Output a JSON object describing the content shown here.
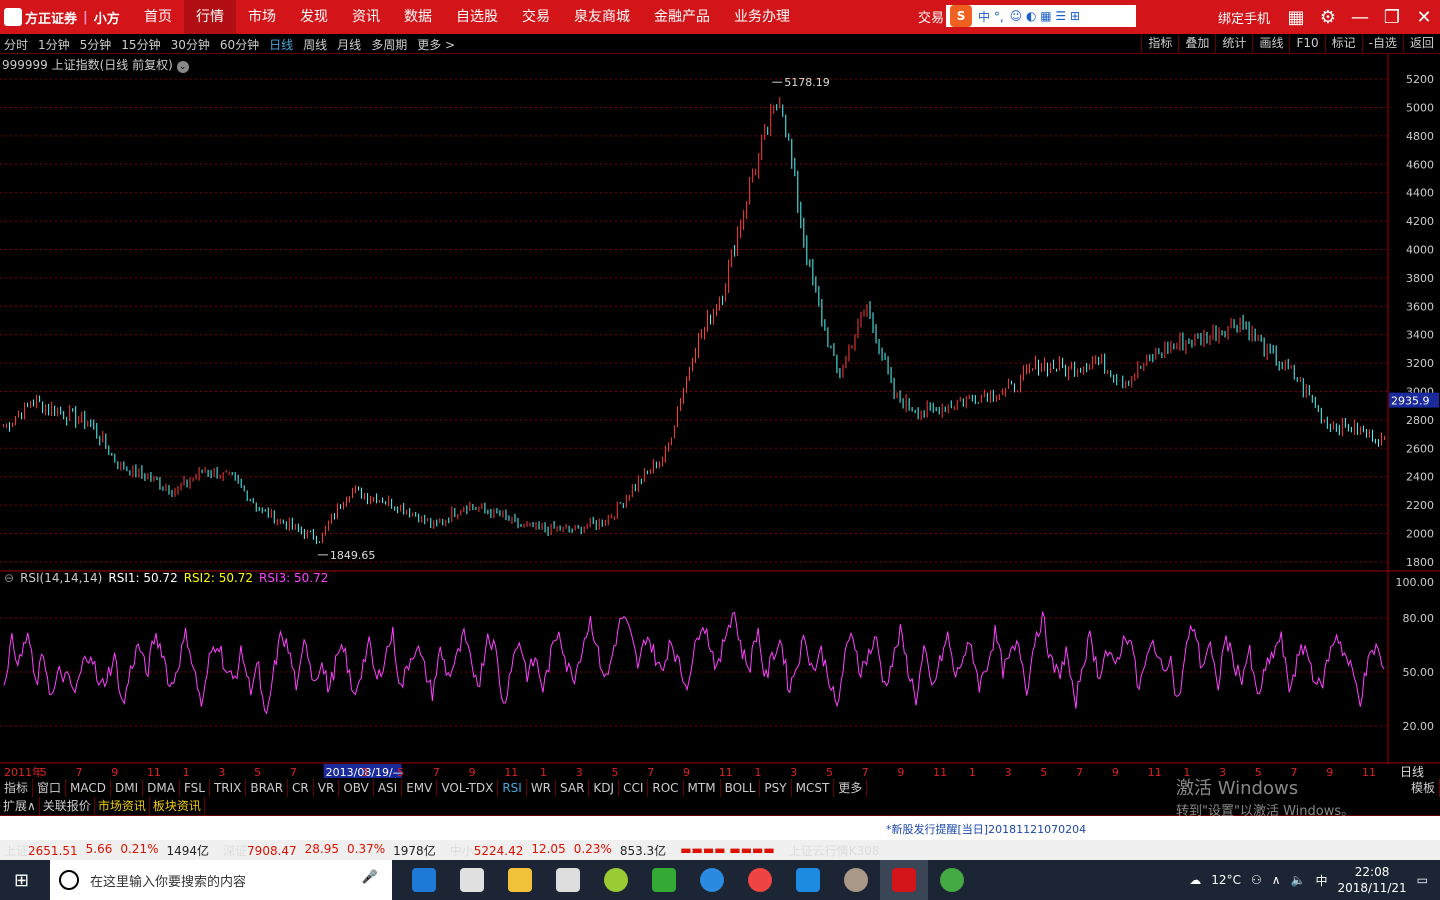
{
  "app": {
    "logo_text": "方正证券",
    "logo_sub": "小方",
    "nav": [
      "首页",
      "行情",
      "市场",
      "发现",
      "资讯",
      "数据",
      "自选股",
      "交易",
      "泉友商城",
      "金融产品",
      "业务办理"
    ],
    "nav_active": "行情",
    "trade_label": "交易",
    "ime_chars": "中 °,",
    "bind_phone": "绑定手机"
  },
  "periodbar": {
    "periods": [
      "分时",
      "1分钟",
      "5分钟",
      "15分钟",
      "30分钟",
      "60分钟",
      "日线",
      "周线",
      "月线",
      "多周期",
      "更多 >"
    ],
    "active": "日线",
    "tools": [
      "指标",
      "叠加",
      "统计",
      "画线",
      "F10",
      "标记",
      "-自选",
      "返回"
    ]
  },
  "chart_info": "999999 上证指数(日线 前复权)",
  "rsi_info": {
    "name": "RSI(14,14,14)",
    "rsi1": "RSI1: 50.72",
    "rsi2": "RSI2: 50.72",
    "rsi3": "RSI3: 50.72"
  },
  "date_labels": [
    "2011年",
    "5",
    "7",
    "9",
    "11",
    "1",
    "3",
    "5",
    "7",
    "2013/08/19/—",
    "3",
    "5",
    "7",
    "9",
    "11",
    "1",
    "3",
    "5",
    "7",
    "9",
    "11",
    "1",
    "3",
    "5",
    "7",
    "9",
    "11",
    "1",
    "3",
    "5",
    "7",
    "9",
    "11",
    "1",
    "3",
    "5",
    "7",
    "9",
    "11"
  ],
  "period_right": "日线",
  "indicator_tabs": [
    "指标",
    "窗口",
    "MACD",
    "DMI",
    "DMA",
    "FSL",
    "TRIX",
    "BRAR",
    "CR",
    "VR",
    "OBV",
    "ASI",
    "EMV",
    "VOL-TDX",
    "RSI",
    "WR",
    "SAR",
    "KDJ",
    "CCI",
    "ROC",
    "MTM",
    "BOLL",
    "PSY",
    "MCST",
    "更多"
  ],
  "indicator_active": "RSI",
  "template_label": "模板",
  "expand_tabs": [
    "扩展∧",
    "关联报价",
    "市场资讯",
    "板块资讯"
  ],
  "notice": "*新股发行提醒[当日]20181121070204",
  "status": {
    "sh": {
      "name": "上证",
      "price": "2651.51",
      "chg": "5.66",
      "pct": "0.21%",
      "amt": "1494亿"
    },
    "sz": {
      "name": "深证",
      "price": "7908.47",
      "chg": "28.95",
      "pct": "0.37%",
      "amt": "1978亿"
    },
    "zx": {
      "name": "中小",
      "price": "5224.42",
      "chg": "12.05",
      "pct": "0.23%",
      "amt": "853.3亿"
    },
    "cloud": "上证云行情K308"
  },
  "watermark": {
    "line1": "激活 Windows",
    "line2": "转到\"设置\"以激活 Windows。"
  },
  "taskbar": {
    "search_placeholder": "在这里输入你要搜索的内容",
    "weather": "12°C",
    "ime": "中",
    "time": "22:08",
    "date": "2018/11/21"
  },
  "colors": {
    "up": "#ff3c3c",
    "down": "#54ffff",
    "rsi": "#ff40ff",
    "grid": "#7a0000",
    "axis": "#a00000"
  },
  "chart_data": [
    {
      "type": "candlestick",
      "title": "999999 上证指数(日线 前复权)",
      "ylim": [
        1750,
        5250
      ],
      "y_ticks": [
        1800,
        2000,
        2200,
        2400,
        2600,
        2800,
        3000,
        3200,
        3400,
        3600,
        3800,
        4000,
        4200,
        4400,
        4600,
        4800,
        5000,
        5200
      ],
      "annotations": [
        {
          "label": "5178.19",
          "value": 5178.19
        },
        {
          "label": "1849.65",
          "value": 1849.65
        }
      ],
      "current_price_label": "2935.9",
      "current_price": 2935.9,
      "x": [
        "2011-01",
        "2011-03",
        "2011-05",
        "2011-07",
        "2011-09",
        "2011-11",
        "2012-01",
        "2012-03",
        "2012-05",
        "2012-07",
        "2012-09",
        "2012-11",
        "2013-01",
        "2013-03",
        "2013-05",
        "2013-07",
        "2013-09",
        "2013-11",
        "2014-01",
        "2014-03",
        "2014-05",
        "2014-07",
        "2014-09",
        "2014-11",
        "2015-01",
        "2015-03",
        "2015-05",
        "2015-06",
        "2015-07",
        "2015-09",
        "2015-11",
        "2016-01",
        "2016-03",
        "2016-05",
        "2016-07",
        "2016-09",
        "2016-11",
        "2017-01",
        "2017-03",
        "2017-05",
        "2017-07",
        "2017-09",
        "2017-11",
        "2018-01",
        "2018-03",
        "2018-05",
        "2018-07",
        "2018-09",
        "2018-11"
      ],
      "close": [
        2750,
        2930,
        2850,
        2780,
        2480,
        2400,
        2300,
        2450,
        2380,
        2150,
        2050,
        1960,
        2300,
        2250,
        2170,
        2050,
        2200,
        2150,
        2050,
        2030,
        2030,
        2100,
        2350,
        2550,
        3300,
        3700,
        4500,
        5100,
        3850,
        3100,
        3600,
        2950,
        2850,
        2920,
        2980,
        3010,
        3200,
        3150,
        3230,
        3060,
        3260,
        3350,
        3400,
        3500,
        3260,
        3080,
        2780,
        2730,
        2650
      ]
    },
    {
      "type": "line",
      "title": "RSI(14,14,14)",
      "ylim": [
        0,
        100
      ],
      "y_ticks": [
        20,
        50,
        80,
        100
      ],
      "series": [
        {
          "name": "RSI3",
          "values": [
            45,
            67,
            55,
            72,
            42,
            60,
            35,
            50,
            46,
            38,
            55,
            62,
            40,
            48,
            58,
            30,
            52,
            66,
            48,
            70,
            62,
            40,
            55,
            72,
            50,
            30,
            60,
            68,
            50,
            45,
            62,
            40,
            55,
            20,
            50,
            72,
            60,
            40,
            70,
            45,
            55,
            40,
            58,
            62,
            35,
            50,
            66,
            44,
            58,
            72,
            40,
            55,
            65,
            52,
            38,
            62,
            48,
            56,
            70,
            52,
            45,
            72,
            62,
            30,
            55,
            68,
            48,
            58,
            40,
            60,
            75,
            52,
            48,
            66,
            80,
            58,
            45,
            66,
            82,
            70,
            52,
            72,
            60,
            48,
            70,
            55,
            42,
            60,
            80,
            66,
            50,
            72,
            85,
            62,
            52,
            75,
            45,
            60,
            68,
            40,
            55,
            70,
            50,
            62,
            48,
            28,
            58,
            72,
            50,
            60,
            68,
            42,
            55,
            72,
            52,
            35,
            62,
            40,
            55,
            70,
            46,
            60,
            64,
            42,
            55,
            72,
            50,
            60,
            65,
            40,
            70,
            80,
            55,
            48,
            62,
            30,
            55,
            70,
            48,
            62,
            52,
            66,
            72,
            40,
            55,
            68,
            50,
            60,
            30,
            62,
            78,
            52,
            66,
            40,
            70,
            56,
            46,
            62,
            35,
            50,
            60,
            70,
            40,
            55,
            65,
            50,
            40,
            58,
            72,
            60,
            50,
            35,
            55,
            65,
            50
          ]
        }
      ]
    }
  ]
}
